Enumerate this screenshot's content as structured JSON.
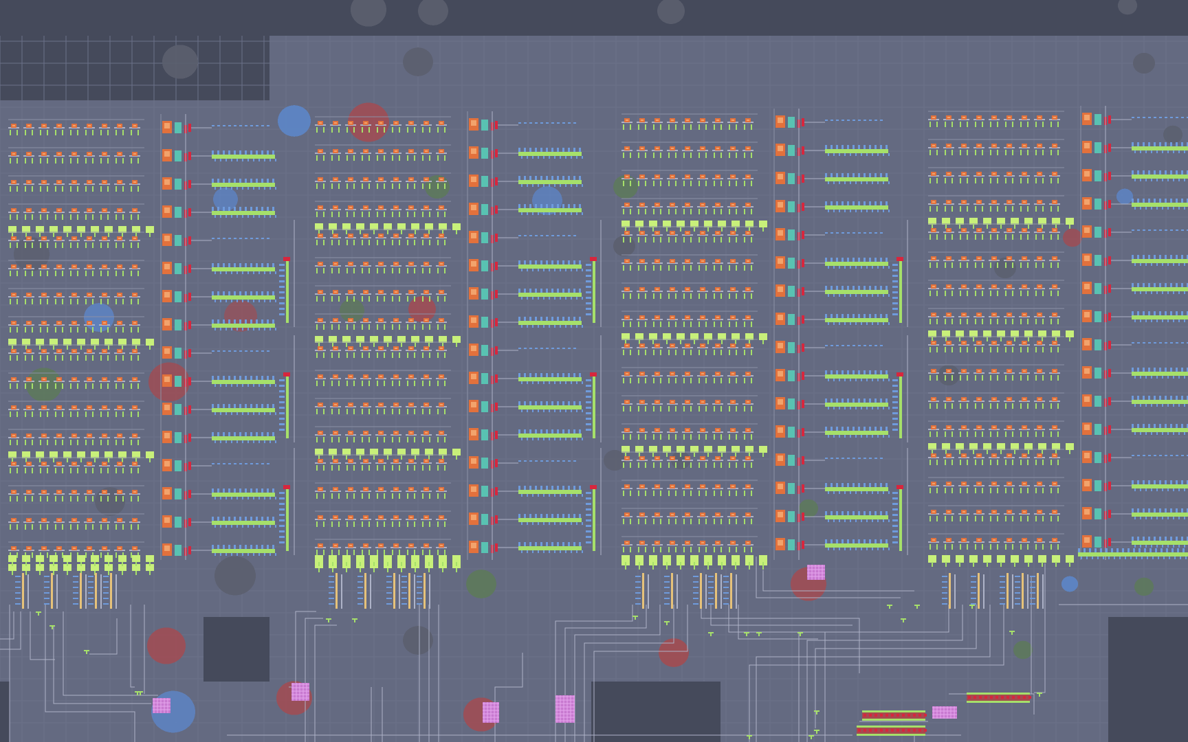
{
  "app": {
    "title": "",
    "view": "circuit-editor"
  },
  "palette": {
    "void": "#454a5b",
    "board": "#646a81",
    "grid": "#6b7189",
    "wire": "#aeb3c8",
    "wire_dark": "#8c91a6",
    "transistor": "#e2713c",
    "transistor_hi": "#f2a36c",
    "output_green": "#a6e06a",
    "green_light": "#c8f07a",
    "pin_blue": "#6f9bdc",
    "cyan": "#59c2b2",
    "pink": "#c879d0",
    "tan": "#e6c27a",
    "red": "#d7263d",
    "dirt_red": "#a64a4f",
    "dirt_green": "#5d7a58",
    "dirt_blue": "#5c86c8",
    "dirt_gray": "#5b5f6e"
  },
  "board": {
    "banks": 4,
    "rows_per_bank": 16,
    "cells_per_row": 11
  },
  "icons": {
    "transistor": "transistor-icon",
    "latch": "latch-icon",
    "pin": "pin-icon",
    "via": "via-icon",
    "rom": "rom-chip-icon"
  }
}
